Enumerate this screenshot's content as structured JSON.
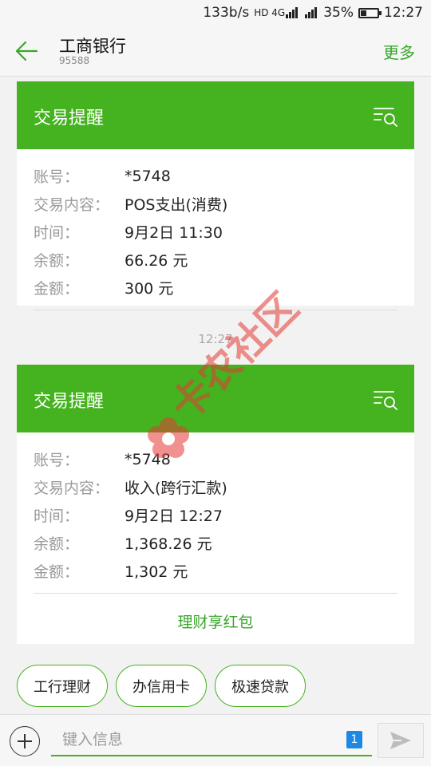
{
  "status_bar": {
    "net_speed": "133b/s",
    "signal_label": "HD 4G",
    "battery": "35%",
    "battery_level": 0.35,
    "time": "12:27"
  },
  "header": {
    "title": "工商银行",
    "subtitle": "95588",
    "more_label": "更多"
  },
  "messages": [
    {
      "card_title": "交易提醒",
      "rows": [
        {
          "label": "账号：",
          "value": "*5748"
        },
        {
          "label": "交易内容：",
          "value": "POS支出(消费)"
        },
        {
          "label": "时间：",
          "value": "9月2日 11:30"
        },
        {
          "label": "余额：",
          "value": "66.26 元"
        },
        {
          "label": "金额：",
          "value": "300 元"
        }
      ]
    },
    {
      "card_title": "交易提醒",
      "rows": [
        {
          "label": "账号：",
          "value": "*5748"
        },
        {
          "label": "交易内容：",
          "value": "收入(跨行汇款)"
        },
        {
          "label": "时间：",
          "value": "9月2日 12:27"
        },
        {
          "label": "余额：",
          "value": "1,368.26 元"
        },
        {
          "label": "金额：",
          "value": "1,302 元"
        }
      ],
      "link_label": "理财享红包"
    }
  ],
  "timestamp": "12:27",
  "watermark": "卡农社区",
  "quick_replies": [
    "工行理财",
    "办信用卡",
    "极速贷款"
  ],
  "input": {
    "placeholder": "键入信息",
    "sim_badge": "1"
  },
  "colors": {
    "accent": "#45b21f",
    "link": "#3aa62b",
    "watermark": "#e53935"
  },
  "icons": {
    "back": "arrow-left-icon",
    "filter": "list-search-icon",
    "plus": "plus-icon",
    "send": "send-icon"
  }
}
